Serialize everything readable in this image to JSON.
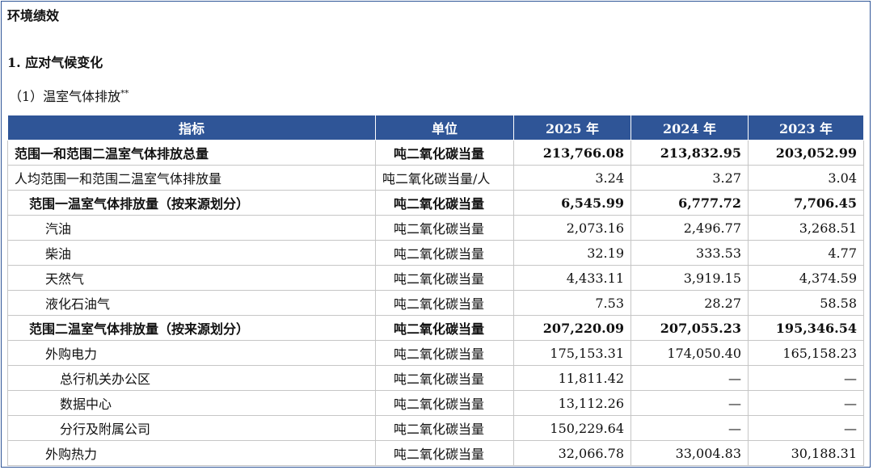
{
  "section_title": "环境绩效",
  "subsection_title": "1. 应对气候变化",
  "subsubsection_title": "（1）温室气体排放",
  "subsubsection_mark": "**",
  "table": {
    "headers": [
      "指标",
      "单位",
      "2025 年",
      "2024 年",
      "2023 年"
    ],
    "rows": [
      {
        "label": "范围一和范围二温室气体排放总量",
        "unit": "吨二氧化碳当量",
        "v2025": "213,766.08",
        "v2024": "213,832.95",
        "v2023": "203,052.99"
      },
      {
        "label": "人均范围一和范围二温室气体排放量",
        "unit": "吨二氧化碳当量/人",
        "v2025": "3.24",
        "v2024": "3.27",
        "v2023": "3.04"
      },
      {
        "label": "范围一温室气体排放量（按来源划分）",
        "unit": "吨二氧化碳当量",
        "v2025": "6,545.99",
        "v2024": "6,777.72",
        "v2023": "7,706.45"
      },
      {
        "label": "汽油",
        "unit": "吨二氧化碳当量",
        "v2025": "2,073.16",
        "v2024": "2,496.77",
        "v2023": "3,268.51"
      },
      {
        "label": "柴油",
        "unit": "吨二氧化碳当量",
        "v2025": "32.19",
        "v2024": "333.53",
        "v2023": "4.77"
      },
      {
        "label": "天然气",
        "unit": "吨二氧化碳当量",
        "v2025": "4,433.11",
        "v2024": "3,919.15",
        "v2023": "4,374.59"
      },
      {
        "label": "液化石油气",
        "unit": "吨二氧化碳当量",
        "v2025": "7.53",
        "v2024": "28.27",
        "v2023": "58.58"
      },
      {
        "label": "范围二温室气体排放量（按来源划分）",
        "unit": "吨二氧化碳当量",
        "v2025": "207,220.09",
        "v2024": "207,055.23",
        "v2023": "195,346.54"
      },
      {
        "label": "外购电力",
        "unit": "吨二氧化碳当量",
        "v2025": "175,153.31",
        "v2024": "174,050.40",
        "v2023": "165,158.23"
      },
      {
        "label": "总行机关办公区",
        "unit": "吨二氧化碳当量",
        "v2025": "11,811.42",
        "v2024": "—",
        "v2023": "—"
      },
      {
        "label": "数据中心",
        "unit": "吨二氧化碳当量",
        "v2025": "13,112.26",
        "v2024": "—",
        "v2023": "—"
      },
      {
        "label": "分行及附属公司",
        "unit": "吨二氧化碳当量",
        "v2025": "150,229.64",
        "v2024": "—",
        "v2023": "—"
      },
      {
        "label": "外购热力",
        "unit": "吨二氧化碳当量",
        "v2025": "32,066.78",
        "v2024": "33,004.83",
        "v2023": "30,188.31"
      }
    ]
  }
}
